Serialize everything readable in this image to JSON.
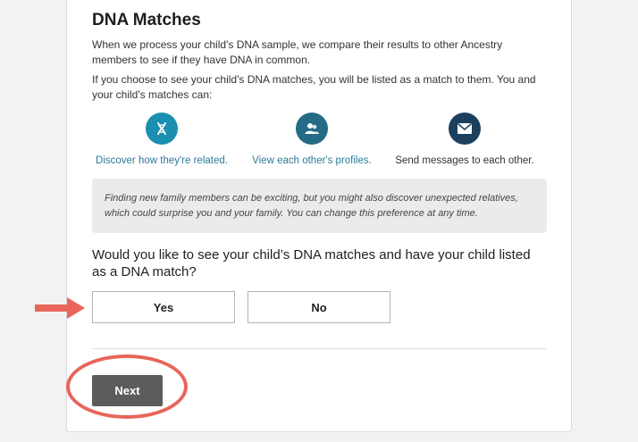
{
  "section": {
    "title": "DNA Matches",
    "intro": "When we process your child's DNA sample, we compare their results to other Ancestry members to see if they have DNA in common.",
    "explain": "If you choose to see your child's DNA matches, you will be listed as a match to them. You and your child's matches can:"
  },
  "features": [
    {
      "label": "Discover how they're related.",
      "icon": "dna-icon",
      "color": "#1a8fb0",
      "text_color": "#2b7a9b"
    },
    {
      "label": "View each other's profiles.",
      "icon": "profiles-icon",
      "color": "#246b85",
      "text_color": "#2b7a9b"
    },
    {
      "label": "Send messages to each other.",
      "icon": "envelope-icon",
      "color": "#1c3f5e",
      "text_color": "#333333"
    }
  ],
  "note": "Finding new family members can be exciting, but you might also discover unexpected relatives, which could surprise you and your family. You can change this preference at any time.",
  "question": "Would you like to see your child’s DNA matches and have your child listed as a DNA match?",
  "choices": {
    "yes": "Yes",
    "no": "No"
  },
  "next_label": "Next",
  "annotation_color": "#e8655a"
}
